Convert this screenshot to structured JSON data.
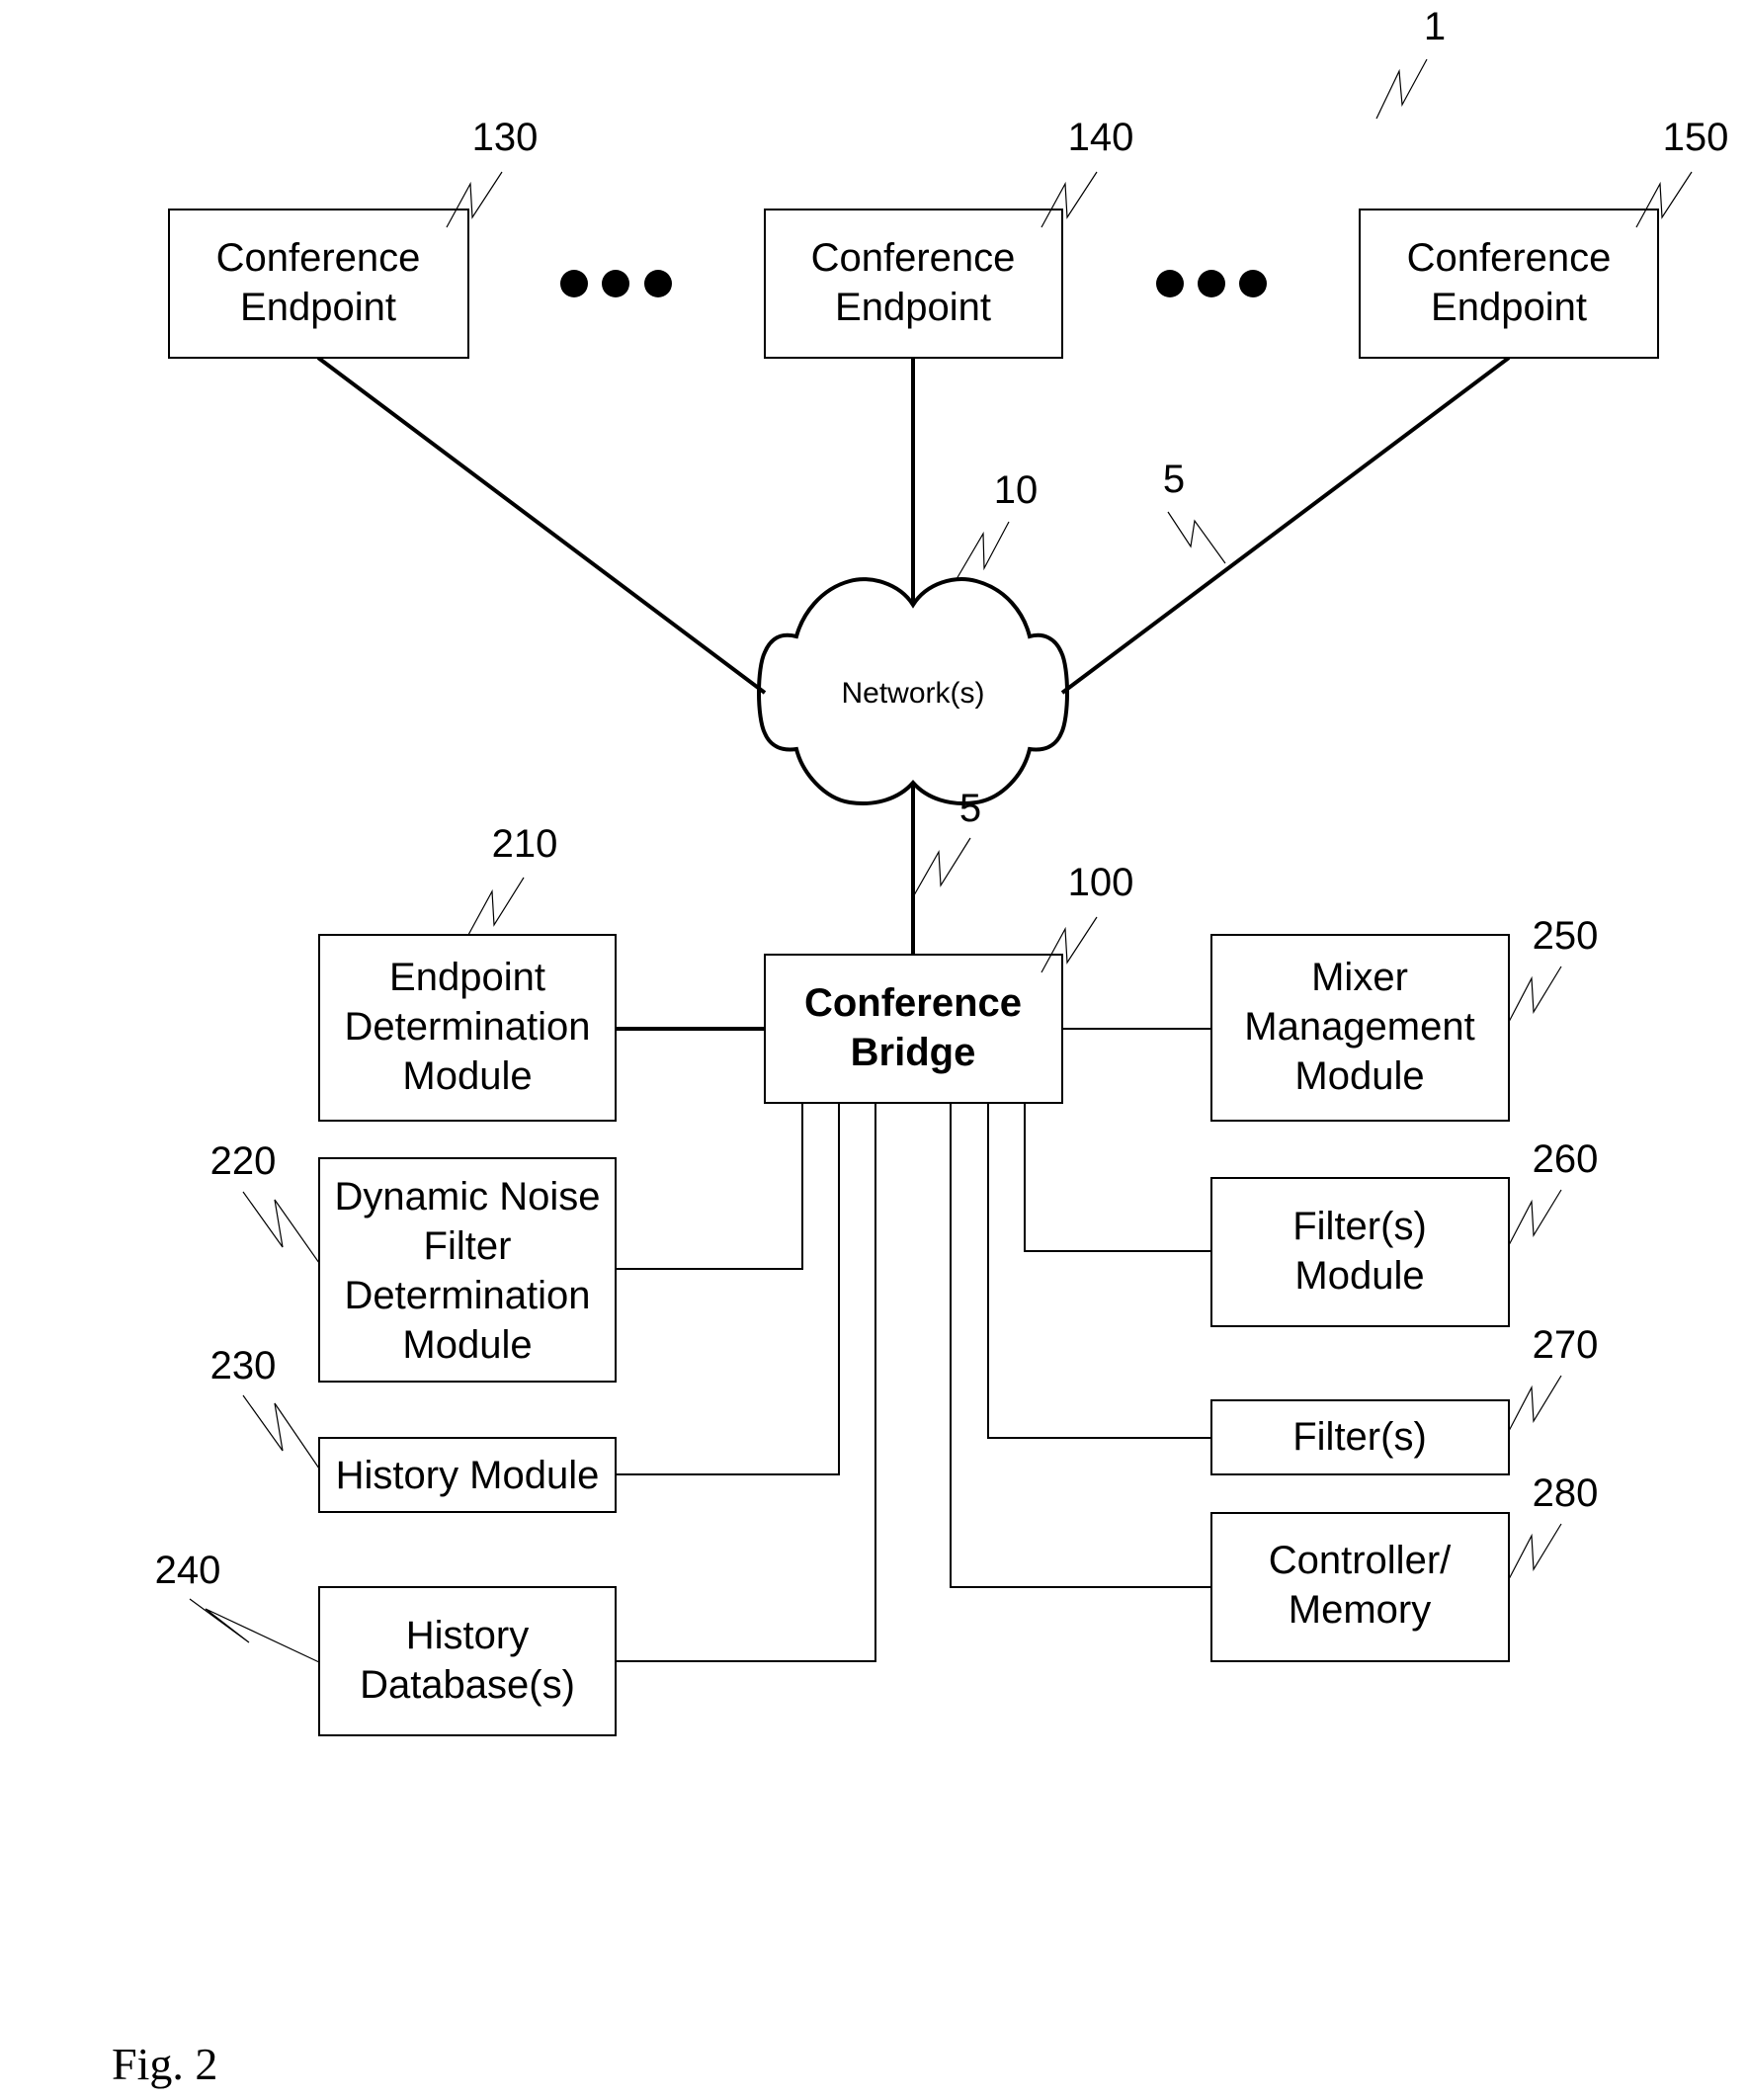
{
  "figure": {
    "caption": "Fig. 2",
    "system_ref": "1"
  },
  "endpoints": [
    {
      "line1": "Conference",
      "line2": "Endpoint",
      "ref": "130"
    },
    {
      "line1": "Conference",
      "line2": "Endpoint",
      "ref": "140"
    },
    {
      "line1": "Conference",
      "line2": "Endpoint",
      "ref": "150"
    }
  ],
  "network": {
    "label": "Network(s)",
    "ref": "10",
    "link_ref_upper": "5",
    "link_ref_lower": "5"
  },
  "bridge": {
    "line1": "Conference",
    "line2": "Bridge",
    "ref": "100"
  },
  "left_modules": [
    {
      "lines": [
        "Endpoint",
        "Determination",
        "Module"
      ],
      "ref": "210"
    },
    {
      "lines": [
        "Dynamic Noise",
        "Filter",
        "Determination",
        "Module"
      ],
      "ref": "220"
    },
    {
      "lines": [
        "History Module"
      ],
      "ref": "230"
    },
    {
      "lines": [
        "History",
        "Database(s)"
      ],
      "ref": "240"
    }
  ],
  "right_modules": [
    {
      "lines": [
        "Mixer",
        "Management",
        "Module"
      ],
      "ref": "250"
    },
    {
      "lines": [
        "Filter(s)",
        "Module"
      ],
      "ref": "260"
    },
    {
      "lines": [
        "Filter(s)"
      ],
      "ref": "270"
    },
    {
      "lines": [
        "Controller/",
        "Memory"
      ],
      "ref": "280"
    }
  ]
}
